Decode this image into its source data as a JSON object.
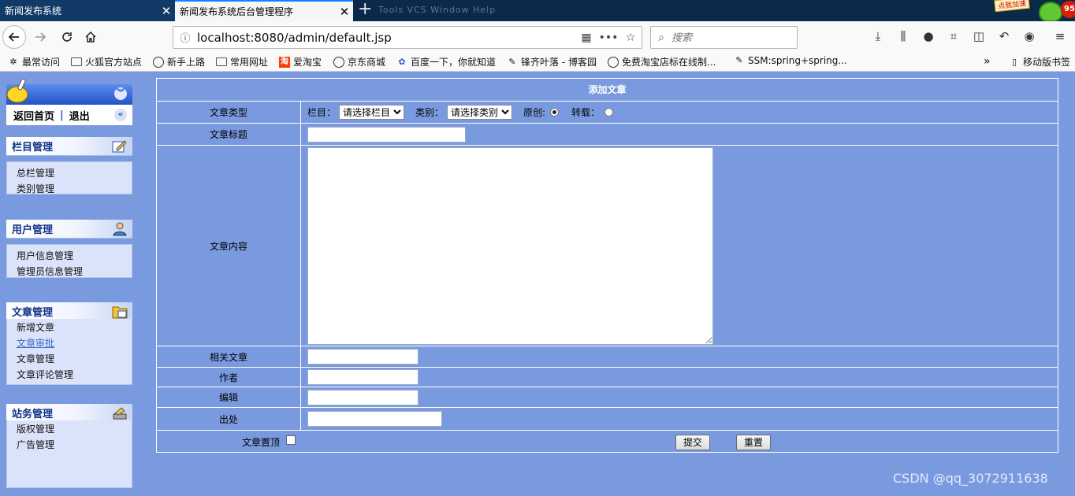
{
  "browser": {
    "tabs": [
      {
        "title": "新闻发布系统",
        "close": "✕"
      },
      {
        "title": "新闻发布系统后台管理程序",
        "close": "✕"
      }
    ],
    "new_tab": "+",
    "ghost_text": "Tools  VCS  Window  Help",
    "badges": {
      "ad": "点我加速",
      "count": "95"
    },
    "url": "localhost:8080/admin/default.jsp",
    "search_placeholder": "搜索",
    "icons": [
      "back-icon",
      "forward-icon",
      "reload-icon",
      "home-icon",
      "info-icon",
      "qr-code-icon",
      "more-icon",
      "star-icon",
      "search-icon",
      "download-icon",
      "library-icon",
      "chat-icon",
      "crop-icon",
      "sidebar-icon",
      "undo-icon",
      "account-icon",
      "menu-icon"
    ]
  },
  "bookmarks": [
    {
      "label": "最常访问",
      "icon": "gear-icon"
    },
    {
      "label": "火狐官方站点",
      "icon": "folder-icon"
    },
    {
      "label": "新手上路",
      "icon": "globe-icon"
    },
    {
      "label": "常用网址",
      "icon": "folder-icon"
    },
    {
      "label": "爱淘宝",
      "icon": "taobao-icon"
    },
    {
      "label": "京东商城",
      "icon": "globe-icon"
    },
    {
      "label": "百度一下，你就知道",
      "icon": "baidu-icon"
    },
    {
      "label": "锋齐叶落 - 博客园",
      "icon": "leaf-icon"
    },
    {
      "label": "免费淘宝店标在线制...",
      "icon": "globe-icon"
    },
    {
      "label": "SSM:spring+spring...",
      "icon": "leaf-icon"
    },
    {
      "label": "»",
      "icon": "chevron-icon"
    },
    {
      "label": "移动版书签",
      "icon": "phone-icon"
    }
  ],
  "sidebar": {
    "home": "返回首页",
    "separator": "|",
    "logout": "退出",
    "sections": [
      {
        "title": "栏目管理",
        "icon": "edit-icon",
        "items": [
          "总栏管理",
          "类别管理"
        ]
      },
      {
        "title": "用户管理",
        "icon": "user-icon",
        "items": [
          "用户信息管理",
          "管理员信息管理"
        ]
      },
      {
        "title": "文章管理",
        "icon": "folder-grid-icon",
        "items": [
          "新增文章",
          "文章审批",
          "文章管理",
          "文章评论管理"
        ]
      },
      {
        "title": "站务管理",
        "icon": "stack-icon",
        "items": [
          "版权管理",
          "广告管理"
        ]
      }
    ]
  },
  "form": {
    "title": "添加文章",
    "type_label": "文章类型",
    "column_label": "栏目：",
    "column_select": "请选择栏目",
    "category_label": "类别：",
    "category_select": "请选择类别",
    "original_label": "原创:",
    "reprint_label": "转载：",
    "original_selected": true,
    "article_title_label": "文章标题",
    "content_label": "文章内容",
    "related_label": "相关文章",
    "author_label": "作者",
    "editor_label": "编辑",
    "source_label": "出处",
    "pin_label": "文章置顶",
    "pin_checked": false,
    "submit": "提交",
    "reset": "重置"
  },
  "watermark": "CSDN @qq_3072911638",
  "colors": {
    "page_bg": "#7a9ae0",
    "menu_header": "#2453c7",
    "menu_body": "#dbe3fa",
    "link": "#3a68c8"
  }
}
